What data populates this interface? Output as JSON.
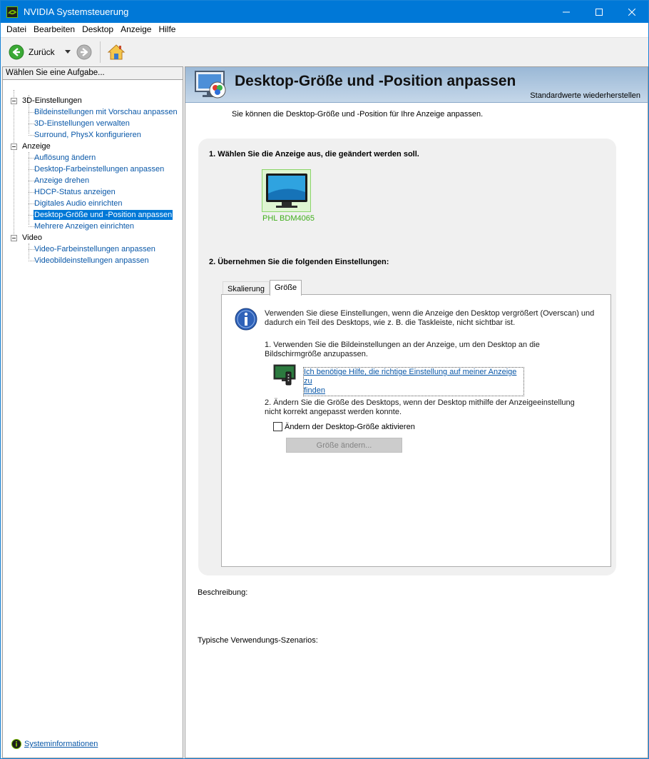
{
  "window": {
    "title": "NVIDIA Systemsteuerung"
  },
  "menu": [
    "Datei",
    "Bearbeiten",
    "Desktop",
    "Anzeige",
    "Hilfe"
  ],
  "toolbar": {
    "back_label": "Zurück"
  },
  "left_panel": {
    "header": "Wählen Sie eine Aufgabe...",
    "categories": [
      {
        "label": "3D-Einstellungen",
        "items": [
          "Bildeinstellungen mit Vorschau anpassen",
          "3D-Einstellungen verwalten",
          "Surround, PhysX konfigurieren"
        ]
      },
      {
        "label": "Anzeige",
        "items": [
          "Auflösung ändern",
          "Desktop-Farbeinstellungen anpassen",
          "Anzeige drehen",
          "HDCP-Status anzeigen",
          "Digitales Audio einrichten",
          "Desktop-Größe und -Position anpassen",
          "Mehrere Anzeigen einrichten"
        ]
      },
      {
        "label": "Video",
        "items": [
          "Video-Farbeinstellungen anpassen",
          "Videobildeinstellungen anpassen"
        ]
      }
    ],
    "selected_item": "Desktop-Größe und -Position anpassen",
    "system_info": "Systeminformationen"
  },
  "main": {
    "title": "Desktop-Größe und -Position anpassen",
    "restore_defaults": "Standardwerte wiederherstellen",
    "intro": "Sie können die Desktop-Größe und -Position für Ihre Anzeige anpassen.",
    "section1": "1. Wählen Sie die Anzeige aus, die geändert werden soll.",
    "display_name": "PHL BDM4065",
    "section2": "2. Übernehmen Sie die folgenden Einstellungen:",
    "tabs": [
      "Skalierung",
      "Größe"
    ],
    "active_tab": "Größe",
    "panel": {
      "info_line1": "Verwenden Sie diese Einstellungen, wenn die Anzeige den Desktop vergrößert (Overscan) und",
      "info_line2": "dadurch ein Teil des Desktops, wie z. B. die Taskleiste, nicht sichtbar ist.",
      "step1_line1": "1. Verwenden Sie die Bildeinstellungen an der Anzeige, um den Desktop an die",
      "step1_line2": "Bildschirmgröße anzupassen.",
      "help_link_line1": "Ich benötige Hilfe, die richtige Einstellung auf meiner Anzeige zu",
      "help_link_line2": "finden",
      "step2_line1": "2. Ändern Sie die Größe des Desktops, wenn der Desktop mithilfe der Anzeigeeinstellung",
      "step2_line2": "nicht korrekt angepasst werden konnte.",
      "checkbox_label": "Ändern der Desktop-Größe aktivieren",
      "checkbox_checked": false,
      "resize_button": "Größe ändern..."
    },
    "description_label": "Beschreibung:",
    "usage_label": "Typische Verwendungs-Szenarios:"
  },
  "colors": {
    "titlebar": "#0078d7",
    "link": "#0a58a8",
    "selection": "#0078d7",
    "display_label": "#3fae1a"
  }
}
